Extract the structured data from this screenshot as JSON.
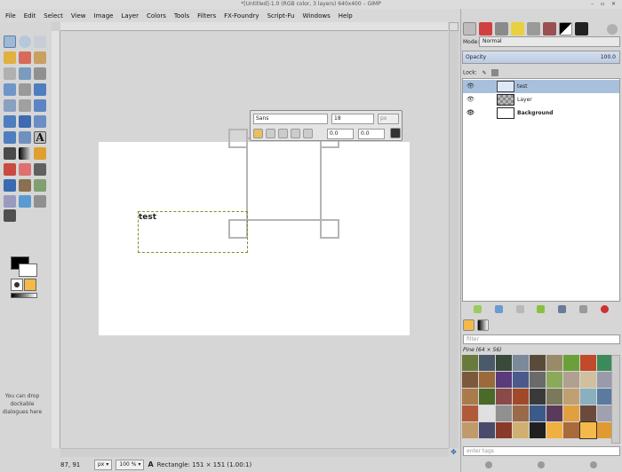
{
  "window": {
    "title": "*[Untitled]-1.0 (RGB color, 3 layers) 640x400 – GIMP",
    "controls": "– ▫ ✕"
  },
  "menu": [
    "File",
    "Edit",
    "Select",
    "View",
    "Image",
    "Layer",
    "Colors",
    "Tools",
    "Filters",
    "FX-Foundry",
    "Script-Fu",
    "Windows",
    "Help"
  ],
  "toolbox": {
    "drop_hint": "You can drop dockable dialogues here",
    "colors": {
      "foreground": "#000000",
      "background": "#ffffff"
    }
  },
  "canvas": {
    "text_content": "test"
  },
  "text_style_editor": {
    "font": "Sans",
    "size": "18",
    "unit": "px",
    "baseline": "0.0",
    "kerning": "0.0"
  },
  "status": {
    "coords": "87, 91",
    "unit": "px",
    "zoom": "100 %",
    "message": "Rectangle: 151 × 151  (1.00:1)"
  },
  "layers_panel": {
    "mode_label": "Mode:",
    "mode_value": "Normal",
    "opacity_label": "Opacity",
    "opacity_value": "100.0",
    "lock_label": "Lock:",
    "layers": [
      {
        "name": "test",
        "selected": true
      },
      {
        "name": "Layer",
        "selected": false
      },
      {
        "name": "Background",
        "selected": false
      }
    ]
  },
  "patterns_panel": {
    "filter_placeholder": "filter",
    "pattern_name": "Pine (64 × 56)",
    "tags_placeholder": "enter tags"
  }
}
